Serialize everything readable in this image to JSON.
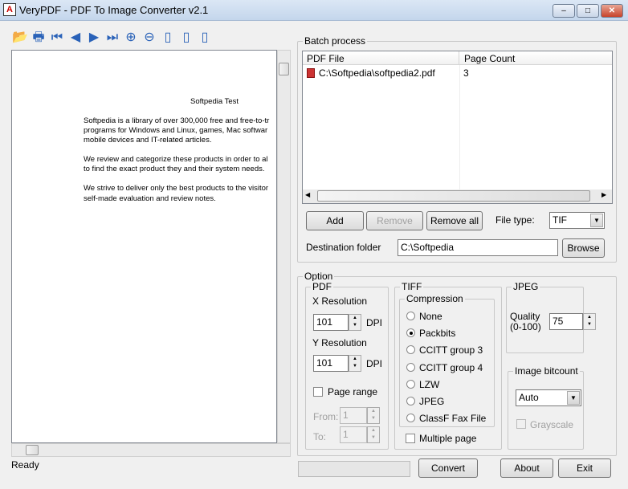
{
  "window": {
    "title": "VeryPDF - PDF To Image Converter v2.1",
    "minimize": "‒",
    "maximize": "□",
    "close": "✕"
  },
  "toolbar": [
    {
      "name": "open-icon",
      "glyph": "📂"
    },
    {
      "name": "print-icon",
      "glyph": "🖶"
    },
    {
      "name": "first-page-icon",
      "glyph": "⏮"
    },
    {
      "name": "prev-page-icon",
      "glyph": "◀"
    },
    {
      "name": "next-page-icon",
      "glyph": "▶"
    },
    {
      "name": "last-page-icon",
      "glyph": "⏭"
    },
    {
      "name": "zoom-in-icon",
      "glyph": "⊕"
    },
    {
      "name": "zoom-out-icon",
      "glyph": "⊖"
    },
    {
      "name": "page-icon",
      "glyph": "▯"
    },
    {
      "name": "fit-page-icon",
      "glyph": "▯"
    },
    {
      "name": "fit-width-icon",
      "glyph": "▯"
    }
  ],
  "preview": {
    "heading": "Softpedia Test",
    "lines": [
      "Softpedia is a library of over 300,000 free and free-to-tr",
      "programs for Windows and Linux, games, Mac softwar",
      "mobile devices and IT-related articles.",
      "We review and categorize these products in order to al",
      "to find the exact product they and their system needs.",
      "We strive to deliver only the best products to the visitor",
      "self-made evaluation and review notes."
    ]
  },
  "status": "Ready",
  "batch": {
    "label": "Batch process",
    "columns": [
      "PDF File",
      "Page Count"
    ],
    "rows": [
      {
        "file": "C:\\Softpedia\\softpedia2.pdf",
        "pages": "3"
      }
    ],
    "add": "Add",
    "remove": "Remove",
    "remove_all": "Remove all",
    "file_type_label": "File type:",
    "file_type": "TIF",
    "dest_label": "Destination folder",
    "dest_value": "C:\\Softpedia",
    "browse": "Browse"
  },
  "option": {
    "label": "Option",
    "pdf": {
      "label": "PDF",
      "xres_label": "X Resolution",
      "xres": "101",
      "yres_label": "Y Resolution",
      "yres": "101",
      "dpi": "DPI",
      "page_range": "Page range",
      "from_label": "From:",
      "from": "1",
      "to_label": "To:",
      "to": "1"
    },
    "tiff": {
      "label": "TIFF",
      "compression_label": "Compression",
      "options": [
        "None",
        "Packbits",
        "CCITT group 3",
        "CCITT group 4",
        "LZW",
        "JPEG",
        "ClassF Fax File"
      ],
      "selected": 1,
      "multiple_page": "Multiple page"
    },
    "jpeg": {
      "label": "JPEG",
      "quality_label1": "Quality",
      "quality_label2": "(0-100)",
      "quality": "75"
    },
    "bitcount": {
      "label": "Image bitcount",
      "value": "Auto",
      "grayscale": "Grayscale"
    }
  },
  "actions": {
    "convert": "Convert",
    "about": "About",
    "exit": "Exit"
  }
}
